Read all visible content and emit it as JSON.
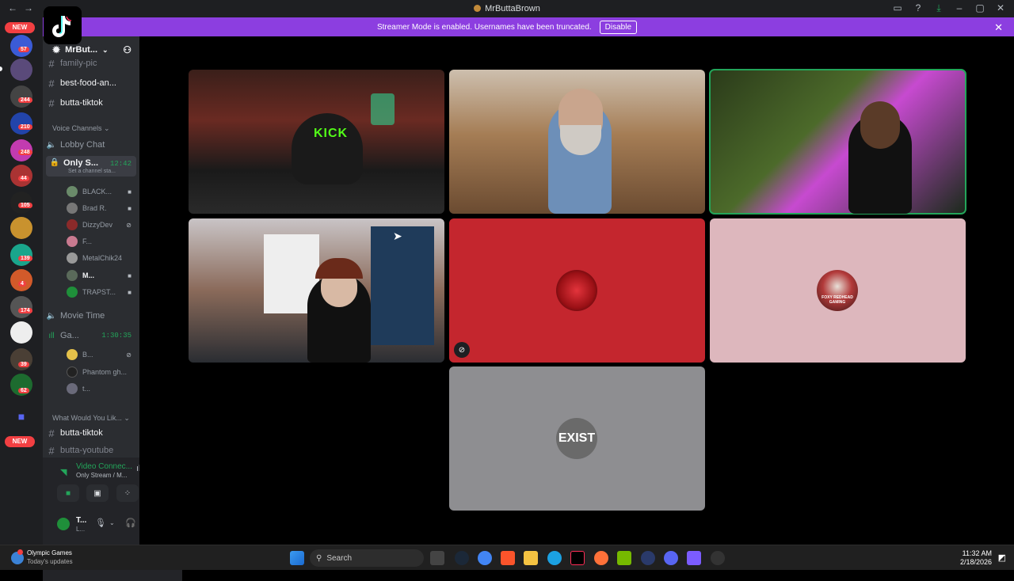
{
  "window": {
    "title": "MrButtaBrown"
  },
  "banner": {
    "text": "Streamer Mode is enabled. Usernames have been truncated.",
    "button": "Disable"
  },
  "servers": {
    "new_top": "NEW",
    "new_bottom": "NEW",
    "badges": [
      "57",
      "244",
      "210",
      "248",
      "44",
      "105",
      "139",
      "4",
      "174",
      "39",
      "62"
    ]
  },
  "guild": {
    "name": "MrBut..."
  },
  "channels": {
    "top": [
      "family-pic",
      "best-food-an...",
      "butta-tiktok"
    ],
    "voice_category": "Voice Channels",
    "lobby": "Lobby Chat",
    "only_stream": {
      "name": "Only S...",
      "time": "12:42",
      "status": "Set a channel sta..."
    },
    "only_stream_users": [
      "BLACK...",
      "Brad R.",
      "DizzyDev",
      "F...",
      "MetalChik24",
      "M...",
      "TRAPST..."
    ],
    "movie": "Movie Time",
    "games": {
      "name": "Ga...",
      "time": "1:30:35"
    },
    "games_users": [
      "B...",
      "Phantom gh...",
      "t..."
    ],
    "category2": "What Would You Lik...",
    "bottom": [
      "butta-tiktok",
      "butta-youtube"
    ]
  },
  "voice_panel": {
    "status": "Video Connec...",
    "channel": "Only Stream / M..."
  },
  "user_panel": {
    "name": "T...",
    "sub": "L..."
  },
  "tiles": [
    {
      "kind": "video",
      "label": "KICK"
    },
    {
      "kind": "video",
      "label": ""
    },
    {
      "kind": "video",
      "label": ""
    },
    {
      "kind": "video",
      "label": ""
    },
    {
      "kind": "avatar",
      "bg": "#c4262e",
      "label": ""
    },
    {
      "kind": "avatar",
      "bg": "#ddb7bd",
      "label": "FOXY REDHEAD GAMING"
    },
    {
      "kind": "avatar",
      "bg": "#8e8e91",
      "label": "EXIST"
    }
  ],
  "taskbar": {
    "news_title": "Olympic Games",
    "news_sub": "Today's updates",
    "search": "Search",
    "time": "11:32 AM",
    "date": "2/18/2026"
  },
  "colors": {
    "banner": "#8c3ee0",
    "speaking": "#23a55a",
    "badge": "#f23f42"
  }
}
